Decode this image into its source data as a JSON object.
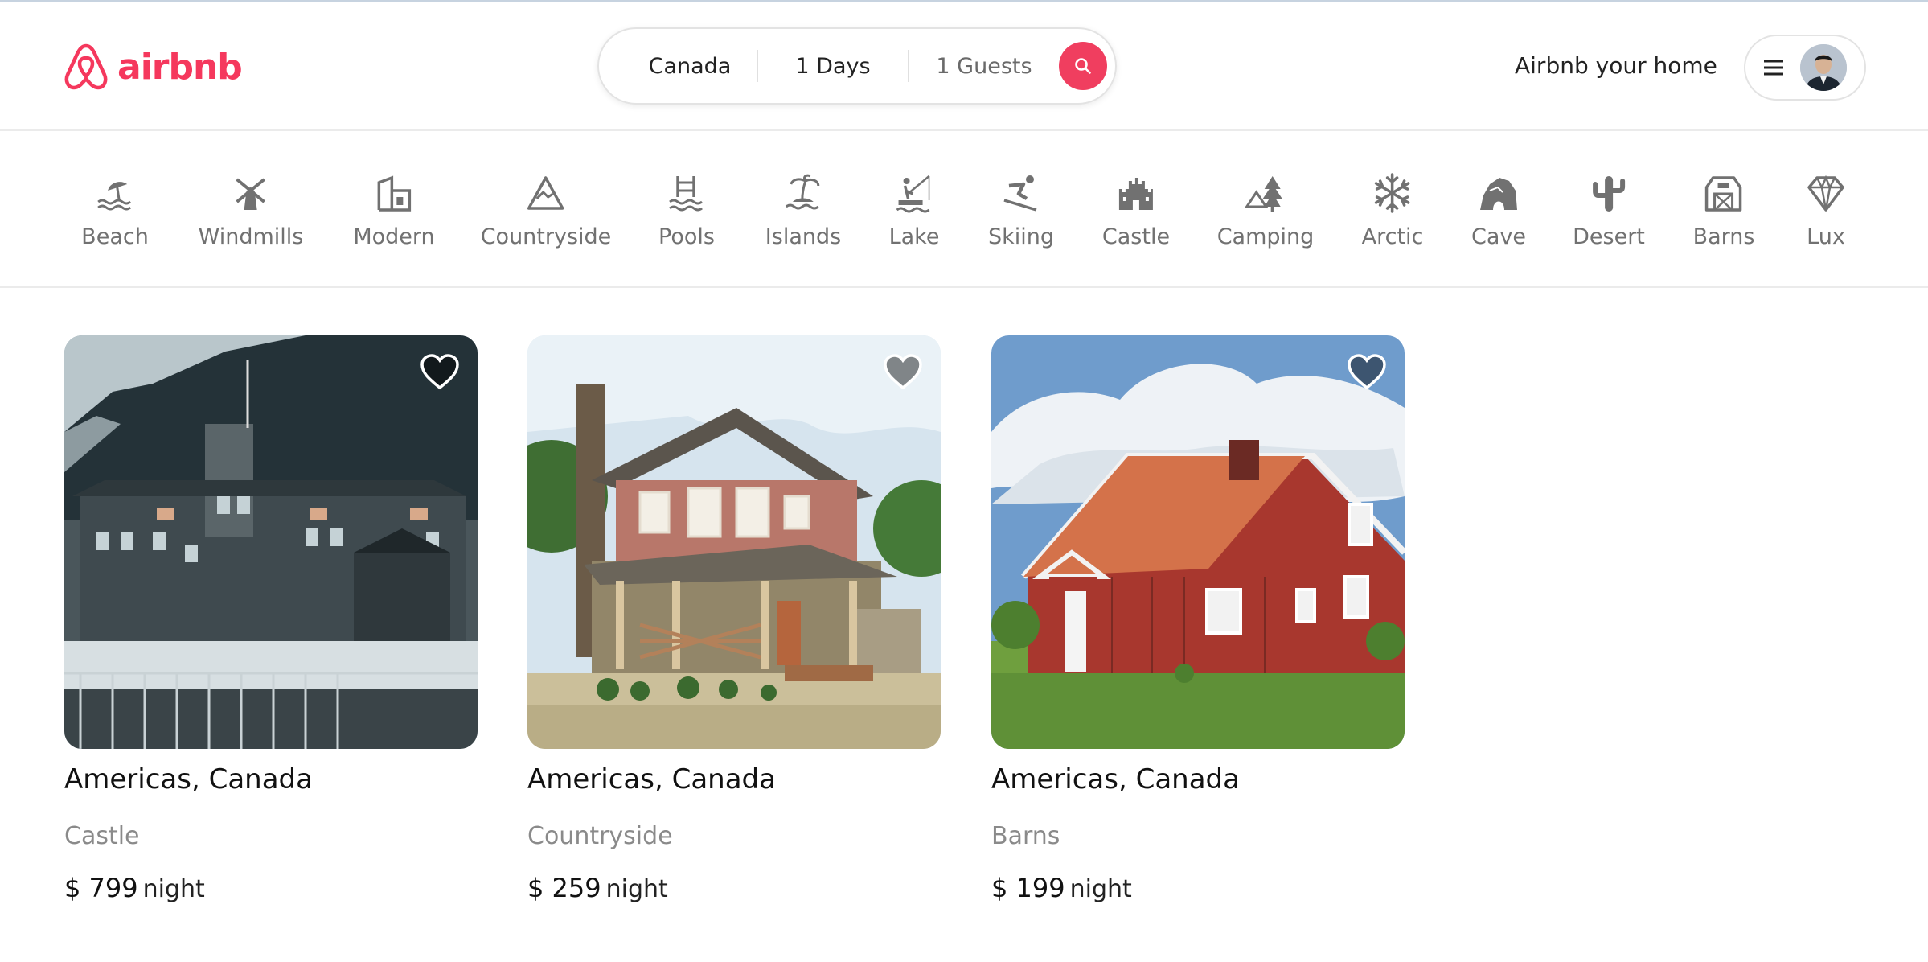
{
  "brand": {
    "name": "airbnb",
    "color": "#F5385D"
  },
  "search": {
    "location": "Canada",
    "days": "1 Days",
    "guests": "1 Guests",
    "button_icon": "search-icon"
  },
  "header": {
    "host_link": "Airbnb your home",
    "menu_icon": "hamburger-icon"
  },
  "categories": [
    {
      "label": "Beach",
      "icon": "beach-icon"
    },
    {
      "label": "Windmills",
      "icon": "windmill-icon"
    },
    {
      "label": "Modern",
      "icon": "modern-house-icon"
    },
    {
      "label": "Countryside",
      "icon": "mountain-icon"
    },
    {
      "label": "Pools",
      "icon": "pool-icon"
    },
    {
      "label": "Islands",
      "icon": "island-icon"
    },
    {
      "label": "Lake",
      "icon": "lake-icon"
    },
    {
      "label": "Skiing",
      "icon": "skiing-icon"
    },
    {
      "label": "Castle",
      "icon": "castle-icon"
    },
    {
      "label": "Camping",
      "icon": "camping-icon"
    },
    {
      "label": "Arctic",
      "icon": "snowflake-icon"
    },
    {
      "label": "Cave",
      "icon": "cave-icon"
    },
    {
      "label": "Desert",
      "icon": "cactus-icon"
    },
    {
      "label": "Barns",
      "icon": "barn-icon"
    },
    {
      "label": "Lux",
      "icon": "diamond-icon"
    }
  ],
  "listings": [
    {
      "location": "Americas, Canada",
      "category": "Castle",
      "price": "$ 799",
      "unit": "night"
    },
    {
      "location": "Americas, Canada",
      "category": "Countryside",
      "price": "$ 259",
      "unit": "night"
    },
    {
      "location": "Americas, Canada",
      "category": "Barns",
      "price": "$ 199",
      "unit": "night"
    }
  ]
}
